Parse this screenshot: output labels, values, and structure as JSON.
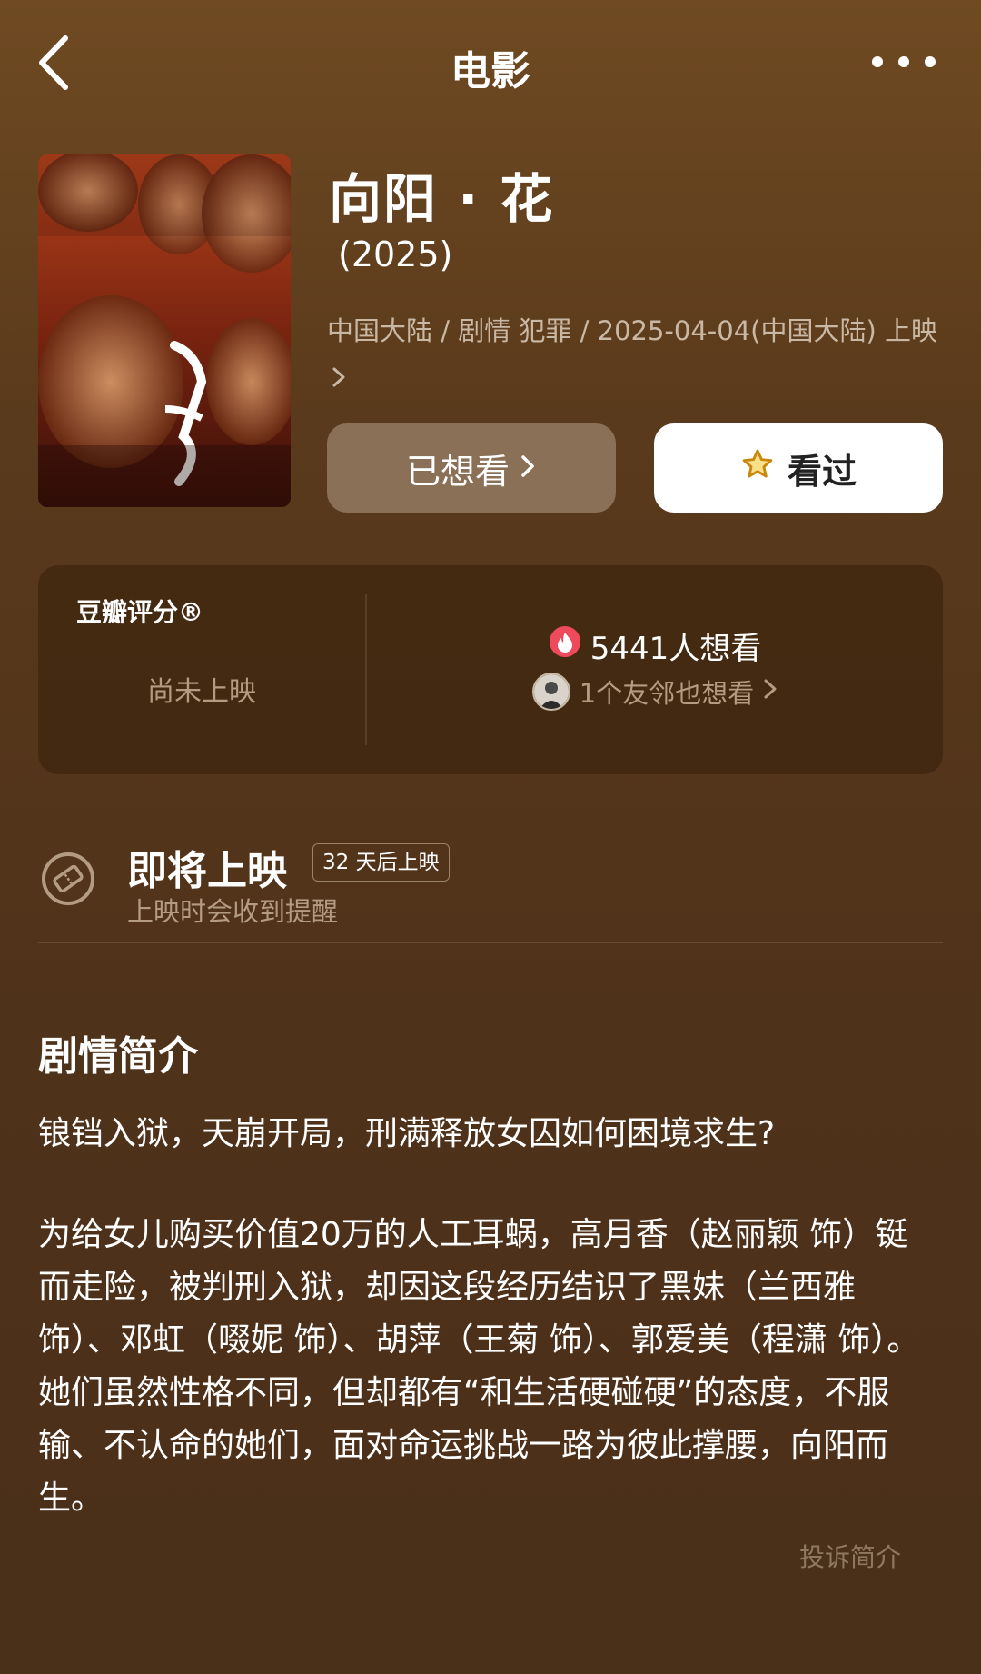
{
  "header": {
    "title": "电影",
    "back_icon": "chevron-left-icon",
    "more_icon": "more-dots-icon"
  },
  "movie": {
    "title": "向阳 · 花",
    "year": "(2025)",
    "meta": "中国大陆 / 剧情 犯罪 / 2025-04-04(中国大陆) 上映",
    "poster_icon": "movie-poster-image"
  },
  "actions": {
    "want_label": "已想看",
    "seen_label": "看过",
    "seen_icon": "star-outline-icon"
  },
  "rating": {
    "label": "豆瓣评分®",
    "status": "尚未上映",
    "want_count": "5441人想看",
    "friends": "1个友邻也想看"
  },
  "release": {
    "title": "即将上映",
    "badge": "32 天后上映",
    "subtitle": "上映时会收到提醒"
  },
  "synopsis": {
    "heading": "剧情简介",
    "tagline": "锒铛入狱，天崩开局，刑满释放女囚如何困境求生?",
    "body": "为给女儿购买价值20万的人工耳蜗，高月香（赵丽颖 饰）铤而走险，被判刑入狱，却因这段经历结识了黑妹（兰西雅 饰）、邓虹（啜妮 饰）、胡萍（王菊 饰）、郭爱美（程潇 饰）。她们虽然性格不同，但却都有“和生活硬碰硬”的态度，不服输、不认命的她们，面对命运挑战一路为彼此撑腰，向阳而生。",
    "report_link": "投诉简介"
  },
  "colors": {
    "background": "#5a3a1c",
    "want_button": "#8a7057",
    "seen_button": "#ffffff",
    "muted_text": "#b49c82",
    "star": "#e0a21a",
    "fire": "#ef4a5c"
  }
}
